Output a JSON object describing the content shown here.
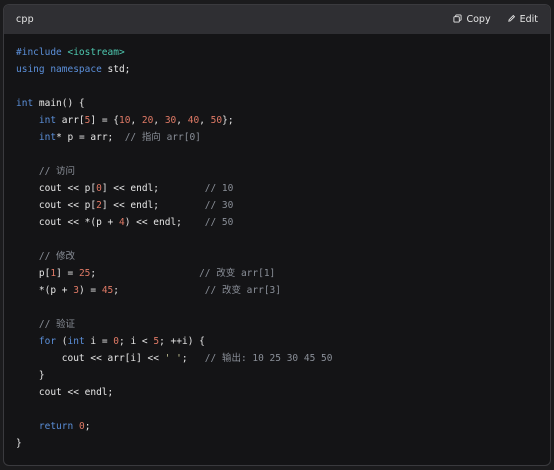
{
  "header": {
    "language": "cpp",
    "copy_label": "Copy",
    "edit_label": "Edit",
    "copy_icon": "copy-icon",
    "edit_icon": "pencil-icon"
  },
  "colors": {
    "keyword": "#5b8fd9",
    "number": "#e07a66",
    "comment": "#8a8f98",
    "include": "#4ec9b0",
    "text": "#e6e6e6",
    "background": "#141416",
    "header_bg": "#2f2f33"
  },
  "code_lines": [
    [
      [
        "#include ",
        "keyword"
      ],
      [
        "<iostream>",
        "include"
      ]
    ],
    [
      [
        "using namespace",
        "keyword"
      ],
      [
        " std;",
        "default"
      ]
    ],
    [],
    [
      [
        "int",
        "keyword"
      ],
      [
        " main() {",
        "default"
      ]
    ],
    [
      [
        "    ",
        "default"
      ],
      [
        "int",
        "keyword"
      ],
      [
        " arr[",
        "default"
      ],
      [
        "5",
        "number"
      ],
      [
        "] = {",
        "default"
      ],
      [
        "10",
        "number"
      ],
      [
        ", ",
        "default"
      ],
      [
        "20",
        "number"
      ],
      [
        ", ",
        "default"
      ],
      [
        "30",
        "number"
      ],
      [
        ", ",
        "default"
      ],
      [
        "40",
        "number"
      ],
      [
        ", ",
        "default"
      ],
      [
        "50",
        "number"
      ],
      [
        "};",
        "default"
      ]
    ],
    [
      [
        "    ",
        "default"
      ],
      [
        "int",
        "keyword"
      ],
      [
        "* p = arr;  ",
        "default"
      ],
      [
        "// 指向 arr[0]",
        "comment"
      ]
    ],
    [],
    [
      [
        "    ",
        "default"
      ],
      [
        "// 访问",
        "comment"
      ]
    ],
    [
      [
        "    cout << p[",
        "default"
      ],
      [
        "0",
        "number"
      ],
      [
        "] << endl;        ",
        "default"
      ],
      [
        "// 10",
        "comment"
      ]
    ],
    [
      [
        "    cout << p[",
        "default"
      ],
      [
        "2",
        "number"
      ],
      [
        "] << endl;        ",
        "default"
      ],
      [
        "// 30",
        "comment"
      ]
    ],
    [
      [
        "    cout << *(p + ",
        "default"
      ],
      [
        "4",
        "number"
      ],
      [
        ") << endl;    ",
        "default"
      ],
      [
        "// 50",
        "comment"
      ]
    ],
    [],
    [
      [
        "    ",
        "default"
      ],
      [
        "// 修改",
        "comment"
      ]
    ],
    [
      [
        "    p[",
        "default"
      ],
      [
        "1",
        "number"
      ],
      [
        "] = ",
        "default"
      ],
      [
        "25",
        "number"
      ],
      [
        ";                  ",
        "default"
      ],
      [
        "// 改变 arr[1]",
        "comment"
      ]
    ],
    [
      [
        "    *(p + ",
        "default"
      ],
      [
        "3",
        "number"
      ],
      [
        ") = ",
        "default"
      ],
      [
        "45",
        "number"
      ],
      [
        ";               ",
        "default"
      ],
      [
        "// 改变 arr[3]",
        "comment"
      ]
    ],
    [],
    [
      [
        "    ",
        "default"
      ],
      [
        "// 验证",
        "comment"
      ]
    ],
    [
      [
        "    ",
        "default"
      ],
      [
        "for",
        "keyword"
      ],
      [
        " (",
        "default"
      ],
      [
        "int",
        "keyword"
      ],
      [
        " i = ",
        "default"
      ],
      [
        "0",
        "number"
      ],
      [
        "; i < ",
        "default"
      ],
      [
        "5",
        "number"
      ],
      [
        "; ++i) {",
        "default"
      ]
    ],
    [
      [
        "        cout << arr[i] << ",
        "default"
      ],
      [
        "' '",
        "string"
      ],
      [
        ";   ",
        "default"
      ],
      [
        "// 输出: 10 25 30 45 50",
        "comment"
      ]
    ],
    [
      [
        "    }",
        "default"
      ]
    ],
    [
      [
        "    cout << endl;",
        "default"
      ]
    ],
    [],
    [
      [
        "    ",
        "default"
      ],
      [
        "return",
        "keyword"
      ],
      [
        " ",
        "default"
      ],
      [
        "0",
        "number"
      ],
      [
        ";",
        "default"
      ]
    ],
    [
      [
        "}",
        "default"
      ]
    ]
  ]
}
